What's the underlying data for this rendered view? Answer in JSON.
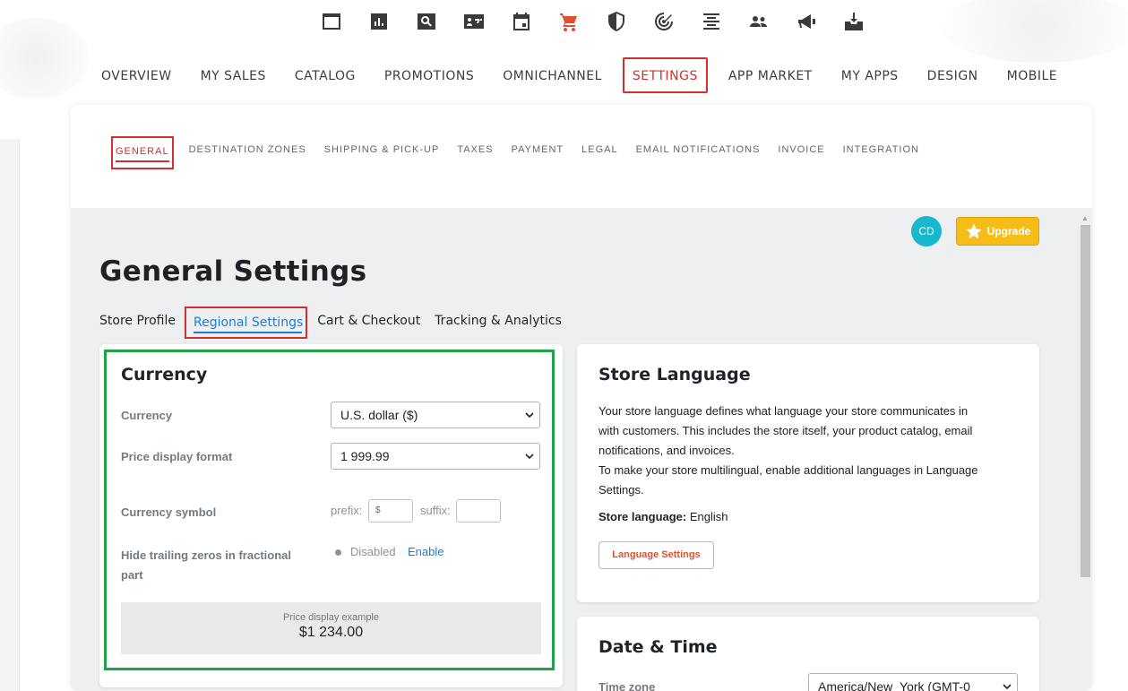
{
  "iconbar": [
    {
      "icon": "dashboard-icon"
    },
    {
      "icon": "bar-chart-icon"
    },
    {
      "icon": "search-box-icon"
    },
    {
      "icon": "contact-card-icon"
    },
    {
      "icon": "calendar-icon"
    },
    {
      "icon": "cart-icon",
      "active": true
    },
    {
      "icon": "shield-icon"
    },
    {
      "icon": "target-icon"
    },
    {
      "icon": "align-center-icon"
    },
    {
      "icon": "people-icon"
    },
    {
      "icon": "megaphone-icon"
    },
    {
      "icon": "inbox-download-icon"
    }
  ],
  "main_nav": [
    "OVERVIEW",
    "MY SALES",
    "CATALOG",
    "PROMOTIONS",
    "OMNICHANNEL",
    "SETTINGS",
    "APP MARKET",
    "MY APPS",
    "DESIGN",
    "MOBILE"
  ],
  "sub_nav": [
    "GENERAL",
    "DESTINATION ZONES",
    "SHIPPING & PICK-UP",
    "TAXES",
    "PAYMENT",
    "LEGAL",
    "EMAIL NOTIFICATIONS",
    "INVOICE",
    "INTEGRATION"
  ],
  "header": {
    "avatar": "CD",
    "upgrade": "Upgrade"
  },
  "page_title": "General Settings",
  "tabs": [
    "Store Profile",
    "Regional Settings",
    "Cart & Checkout",
    "Tracking & Analytics"
  ],
  "currency": {
    "title": "Currency",
    "currency_label": "Currency",
    "currency_value": "U.S. dollar ($)",
    "format_label": "Price display format",
    "format_value": "1 999.99",
    "symbol_label": "Currency symbol",
    "prefix_label": "prefix:",
    "prefix_value": "$",
    "suffix_label": "suffix:",
    "suffix_value": "",
    "zeros_label_1": "Hide trailing zeros in fractional",
    "zeros_label_2": "part",
    "zeros_status": "Disabled",
    "zeros_link": "Enable",
    "example_caption": "Price display example",
    "example_value": "$1 234.00"
  },
  "store_language": {
    "title": "Store Language",
    "p1_l1": "Your store language defines what language your store communicates in",
    "p1_l2": "with customers. This includes the store itself, your product catalog, email",
    "p1_l3": "notifications, and invoices.",
    "p2_l1": "To make your store multilingual, enable additional languages in Language",
    "p2_l2": "Settings.",
    "store_lang_label": "Store language:",
    "store_lang_value": "English",
    "button": "Language Settings"
  },
  "date_time": {
    "title": "Date & Time",
    "tz_label": "Time zone",
    "tz_value": "America/New_York (GMT-0"
  },
  "colors": {
    "accent_red": "#d32f2f",
    "link_blue": "#1f7dd6",
    "highlight_green": "#1fa346",
    "upgrade_yellow": "#f6bd19",
    "avatar_teal": "#17b7cd"
  }
}
